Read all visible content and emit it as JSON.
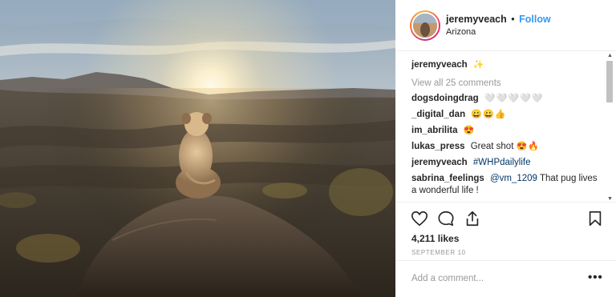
{
  "post": {
    "username": "jeremyveach",
    "separator": "•",
    "follow_label": "Follow",
    "location": "Arizona"
  },
  "caption": {
    "username": "jeremyveach",
    "emoji": "✨"
  },
  "view_all_label": "View all 25 comments",
  "comments": [
    {
      "user": "dogsdoingdrag",
      "text": "",
      "emoji": "🤍🤍🤍🤍🤍"
    },
    {
      "user": "_digital_dan",
      "text": "",
      "emoji": "😀😀👍"
    },
    {
      "user": "im_abrilita",
      "text": "",
      "emoji": "😍"
    },
    {
      "user": "lukas_press",
      "text": "Great shot",
      "emoji": "😍🔥"
    },
    {
      "user": "jeremyveach",
      "tag": "#WHPdailylife",
      "text": ""
    },
    {
      "user": "sabrina_feelings",
      "tag": "@vm_1209",
      "text": "That pug lives a wonderful life !"
    }
  ],
  "icons": {
    "like": "heart-icon",
    "comment": "comment-icon",
    "share": "share-icon",
    "save": "bookmark-icon",
    "more": "more-options-icon"
  },
  "likes_label": "4,211 likes",
  "date_label": "SEPTEMBER 10",
  "add_comment_placeholder": "Add a comment...",
  "more_label": "•••",
  "colors": {
    "link": "#3897f0",
    "hashtag": "#003569",
    "muted": "#999999",
    "text": "#262626"
  }
}
